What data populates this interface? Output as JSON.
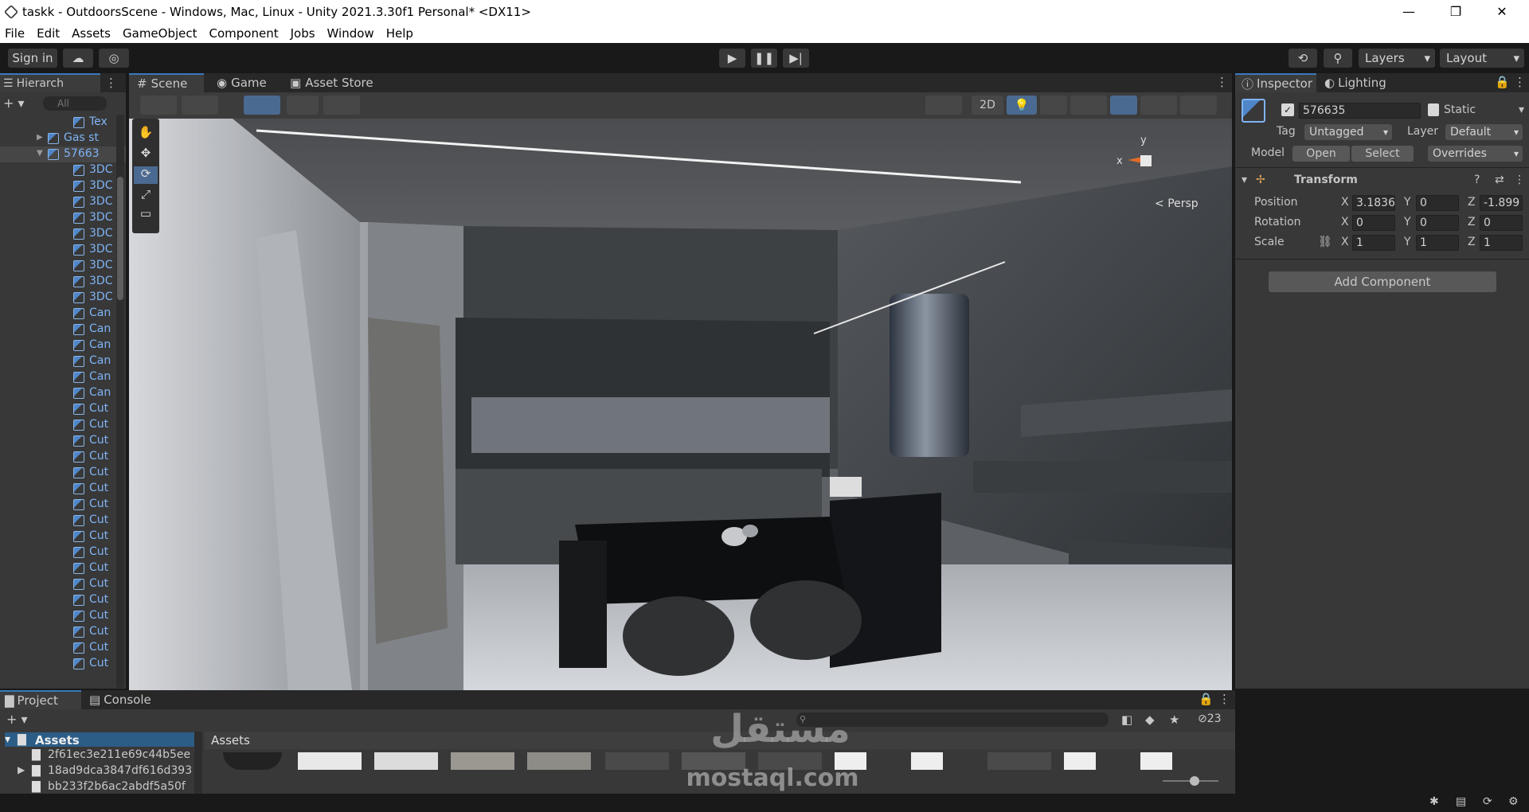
{
  "window": {
    "title": "taskk - OutdoorsScene - Windows, Mac, Linux - Unity 2021.3.30f1 Personal* <DX11>",
    "minimize": "—",
    "maximize": "❐",
    "close": "✕"
  },
  "menu": [
    "File",
    "Edit",
    "Assets",
    "GameObject",
    "Component",
    "Jobs",
    "Window",
    "Help"
  ],
  "toolbar": {
    "sign_in": "Sign in",
    "layers": "Layers",
    "layout": "Layout"
  },
  "hierarchy": {
    "tab": "Hierarch",
    "search_placeholder": "All",
    "rows": [
      {
        "label": "Tex",
        "indent": 2
      },
      {
        "label": "Gas st",
        "indent": 1,
        "arrow": "▶"
      },
      {
        "label": "57663",
        "indent": 1,
        "arrow": "▼",
        "selected": true
      },
      {
        "label": "3DC",
        "indent": 2
      },
      {
        "label": "3DC",
        "indent": 2
      },
      {
        "label": "3DC",
        "indent": 2
      },
      {
        "label": "3DC",
        "indent": 2
      },
      {
        "label": "3DC",
        "indent": 2
      },
      {
        "label": "3DC",
        "indent": 2
      },
      {
        "label": "3DC",
        "indent": 2
      },
      {
        "label": "3DC",
        "indent": 2
      },
      {
        "label": "3DC",
        "indent": 2
      },
      {
        "label": "Can",
        "indent": 2
      },
      {
        "label": "Can",
        "indent": 2
      },
      {
        "label": "Can",
        "indent": 2
      },
      {
        "label": "Can",
        "indent": 2
      },
      {
        "label": "Can",
        "indent": 2
      },
      {
        "label": "Can",
        "indent": 2
      },
      {
        "label": "Cut",
        "indent": 2
      },
      {
        "label": "Cut",
        "indent": 2
      },
      {
        "label": "Cut",
        "indent": 2
      },
      {
        "label": "Cut",
        "indent": 2
      },
      {
        "label": "Cut",
        "indent": 2
      },
      {
        "label": "Cut",
        "indent": 2
      },
      {
        "label": "Cut",
        "indent": 2
      },
      {
        "label": "Cut",
        "indent": 2
      },
      {
        "label": "Cut",
        "indent": 2
      },
      {
        "label": "Cut",
        "indent": 2
      },
      {
        "label": "Cut",
        "indent": 2
      },
      {
        "label": "Cut",
        "indent": 2
      },
      {
        "label": "Cut",
        "indent": 2
      },
      {
        "label": "Cut",
        "indent": 2
      },
      {
        "label": "Cut",
        "indent": 2
      },
      {
        "label": "Cut",
        "indent": 2
      },
      {
        "label": "Cut",
        "indent": 2
      }
    ]
  },
  "scene_tabs": [
    "Scene",
    "Game",
    "Asset Store"
  ],
  "scene": {
    "mode_2d": "2D",
    "persp": "Persp",
    "axis_y": "y",
    "axis_x": "x"
  },
  "inspector": {
    "tabs": [
      "Inspector",
      "Lighting"
    ],
    "object_name": "576635",
    "static_label": "Static",
    "tag_label": "Tag",
    "tag_value": "Untagged",
    "layer_label": "Layer",
    "layer_value": "Default",
    "model_label": "Model",
    "open": "Open",
    "select": "Select",
    "overrides": "Overrides",
    "transform_title": "Transform",
    "position_label": "Position",
    "rotation_label": "Rotation",
    "scale_label": "Scale",
    "position": {
      "x": "3.1836",
      "y": "0",
      "z": "-1.899"
    },
    "rotation": {
      "x": "0",
      "y": "0",
      "z": "0"
    },
    "scale": {
      "x": "1",
      "y": "1",
      "z": "1"
    },
    "axis_x": "X",
    "axis_y": "Y",
    "axis_z": "Z",
    "add_component": "Add Component"
  },
  "project": {
    "tabs": [
      "Project",
      "Console"
    ],
    "assets_root": "Assets",
    "assets_header": "Assets",
    "folders": [
      "2f61ec3e211e69c44b5ee",
      "18ad9dca3847df616d393",
      "bb233f2b6ac2abdf5a50f"
    ],
    "hidden_count": "23"
  },
  "watermark": {
    "arabic": "مستقل",
    "latin": "mostaql.com"
  }
}
